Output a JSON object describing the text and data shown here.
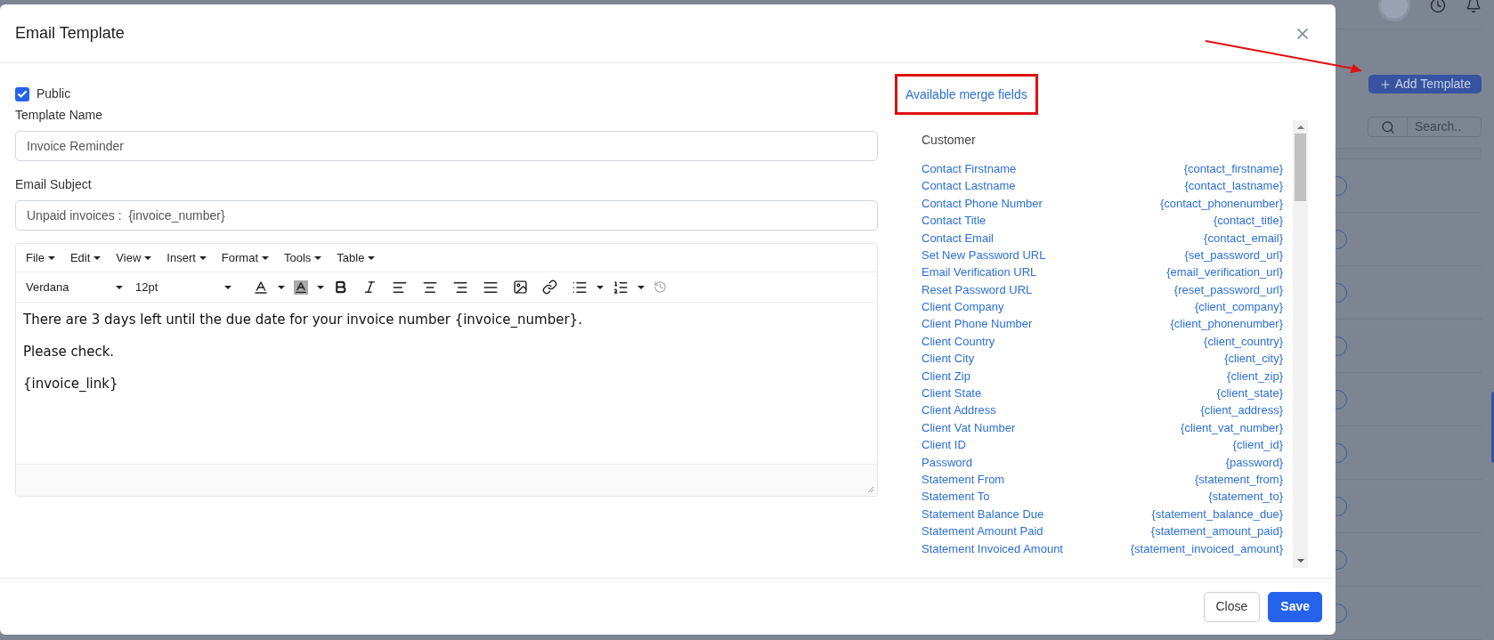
{
  "background": {
    "add_button": "Add Template",
    "search_placeholder": "Search.."
  },
  "dialog": {
    "title": "Email Template",
    "public": {
      "label": "Public",
      "checked": true
    },
    "fields": [
      {
        "label": "Template Name",
        "value": "Invoice Reminder"
      },
      {
        "label": "Email Subject",
        "value": "Unpaid invoices :  {invoice_number}"
      }
    ],
    "editor": {
      "menus": [
        "File",
        "Edit",
        "View",
        "Insert",
        "Format",
        "Tools",
        "Table"
      ],
      "font": "Verdana",
      "size": "12pt",
      "paragraphs": [
        "There are 3 days left until the due date for your invoice number {invoice_number}.",
        "Please check.",
        "{invoice_link}"
      ]
    },
    "merge_fields": {
      "title": "Available merge fields",
      "group": "Customer",
      "items": [
        {
          "name": "Contact Firstname",
          "code": "{contact_firstname}"
        },
        {
          "name": "Contact Lastname",
          "code": "{contact_lastname}"
        },
        {
          "name": "Contact Phone Number",
          "code": "{contact_phonenumber}"
        },
        {
          "name": "Contact Title",
          "code": "{contact_title}"
        },
        {
          "name": "Contact Email",
          "code": "{contact_email}"
        },
        {
          "name": "Set New Password URL",
          "code": "{set_password_url}"
        },
        {
          "name": "Email Verification URL",
          "code": "{email_verification_url}"
        },
        {
          "name": "Reset Password URL",
          "code": "{reset_password_url}"
        },
        {
          "name": "Client Company",
          "code": "{client_company}"
        },
        {
          "name": "Client Phone Number",
          "code": "{client_phonenumber}"
        },
        {
          "name": "Client Country",
          "code": "{client_country}"
        },
        {
          "name": "Client City",
          "code": "{client_city}"
        },
        {
          "name": "Client Zip",
          "code": "{client_zip}"
        },
        {
          "name": "Client State",
          "code": "{client_state}"
        },
        {
          "name": "Client Address",
          "code": "{client_address}"
        },
        {
          "name": "Client Vat Number",
          "code": "{client_vat_number}"
        },
        {
          "name": "Client ID",
          "code": "{client_id}"
        },
        {
          "name": "Password",
          "code": "{password}"
        },
        {
          "name": "Statement From",
          "code": "{statement_from}"
        },
        {
          "name": "Statement To",
          "code": "{statement_to}"
        },
        {
          "name": "Statement Balance Due",
          "code": "{statement_balance_due}"
        },
        {
          "name": "Statement Amount Paid",
          "code": "{statement_amount_paid}"
        },
        {
          "name": "Statement Invoiced Amount",
          "code": "{statement_invoiced_amount}"
        }
      ]
    },
    "buttons": [
      {
        "label": "Close",
        "kind": "secondary"
      },
      {
        "label": "Save",
        "kind": "primary"
      }
    ]
  }
}
